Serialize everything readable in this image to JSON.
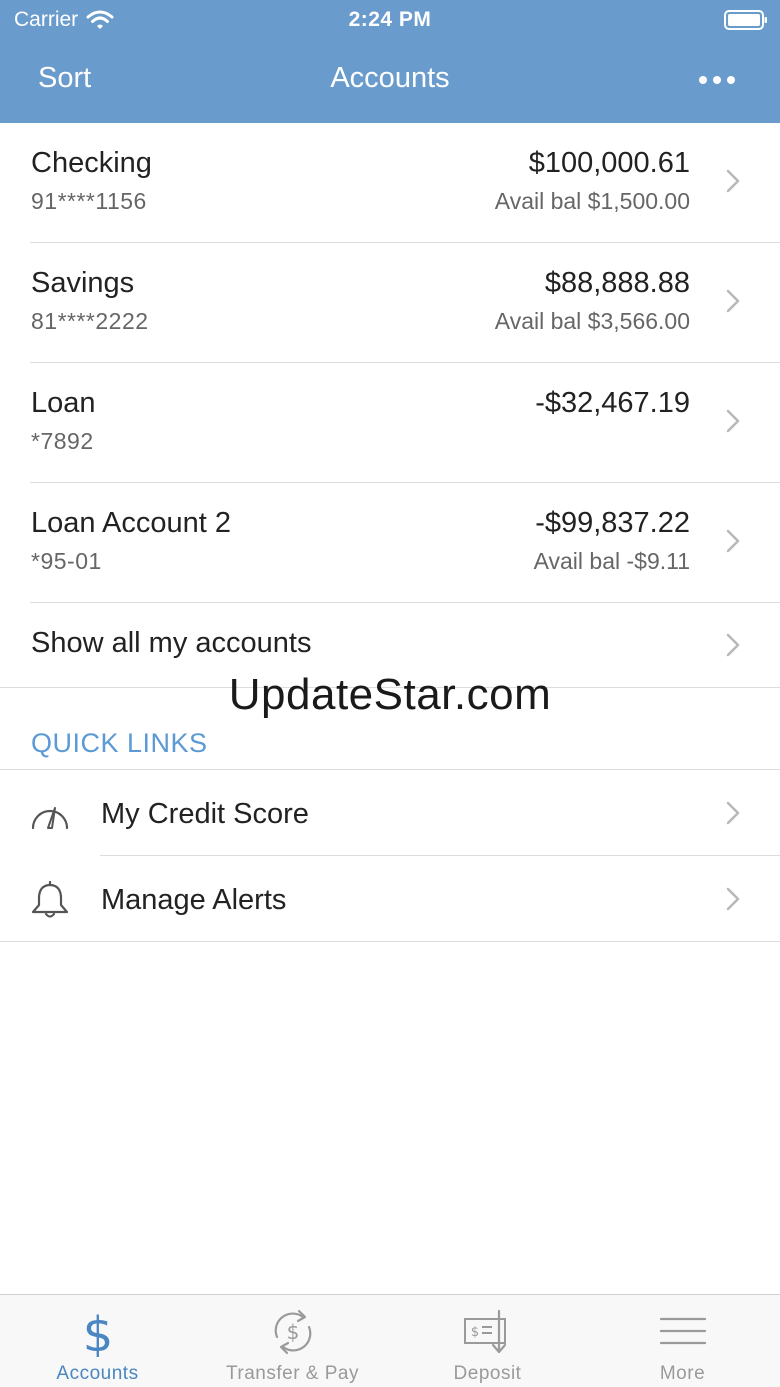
{
  "status_bar": {
    "carrier": "Carrier",
    "time": "2:24 PM"
  },
  "nav": {
    "sort_label": "Sort",
    "title": "Accounts",
    "more_icon": "ellipsis-icon"
  },
  "accounts": [
    {
      "name": "Checking",
      "number": "91****1156",
      "balance": "$100,000.61",
      "available": "Avail bal $1,500.00"
    },
    {
      "name": "Savings",
      "number": "81****2222",
      "balance": "$88,888.88",
      "available": "Avail bal $3,566.00"
    },
    {
      "name": "Loan",
      "number": "*7892",
      "balance": "-$32,467.19",
      "available": ""
    },
    {
      "name": "Loan Account 2",
      "number": "*95-01",
      "balance": "-$99,837.22",
      "available": "Avail bal -$9.11"
    }
  ],
  "show_all": "Show all my accounts",
  "watermark": "UpdateStar.com",
  "quick_links": {
    "header": "QUICK LINKS",
    "items": [
      {
        "label": "My Credit Score",
        "icon": "gauge-icon"
      },
      {
        "label": "Manage Alerts",
        "icon": "bell-icon"
      }
    ]
  },
  "tabs": [
    {
      "label": "Accounts",
      "icon": "dollar-icon",
      "active": true
    },
    {
      "label": "Transfer & Pay",
      "icon": "transfer-icon",
      "active": false
    },
    {
      "label": "Deposit",
      "icon": "check-deposit-icon",
      "active": false
    },
    {
      "label": "More",
      "icon": "menu-icon",
      "active": false
    }
  ],
  "colors": {
    "header_bg": "#6a9bcd",
    "accent": "#4a86c2",
    "quick_links_header": "#5b9ad4",
    "inactive_tab": "#9a9a9a"
  }
}
